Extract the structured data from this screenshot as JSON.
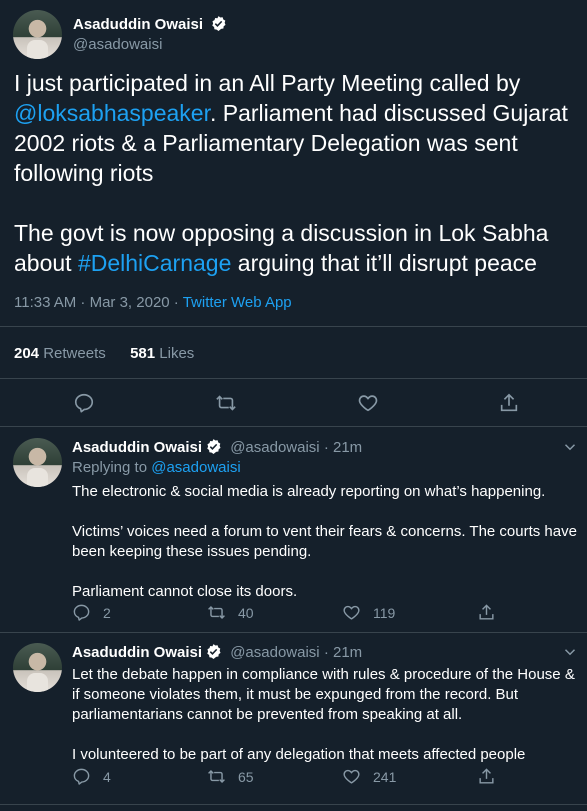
{
  "main_tweet": {
    "author_name": "Asaduddin Owaisi",
    "author_handle": "@asadowaisi",
    "text_part1": "I just participated in an All Party Meeting called by ",
    "mention": "@loksabhaspeaker",
    "text_part2": ". Parliament had discussed Gujarat 2002 riots & a Parliamentary Delegation was sent following riots\n\nThe govt is now opposing a discussion in Lok Sabha about ",
    "hashtag": "#DelhiCarnage",
    "text_part3": " arguing that it’ll disrupt peace",
    "timestamp": "11:33 AM · Mar 3, 2020 · ",
    "source": "Twitter Web App",
    "retweets_count": "204",
    "retweets_label": "Retweets",
    "likes_count": "581",
    "likes_label": "Likes",
    "icons": [
      "reply-icon",
      "retweet-icon",
      "like-icon",
      "share-icon"
    ]
  },
  "replies": [
    {
      "author_name": "Asaduddin Owaisi",
      "author_handle": "@asadowaisi",
      "time": "· 21m",
      "replying_prefix": "Replying to ",
      "replying_handle": "@asadowaisi",
      "text": "The electronic & social media is already reporting on what’s happening.\n\nVictims’ voices need a forum to vent their fears & concerns. The courts have been keeping these issues pending.\n\nParliament cannot close its doors.",
      "reply_count": "2",
      "retweet_count": "40",
      "like_count": "119"
    },
    {
      "author_name": "Asaduddin Owaisi",
      "author_handle": "@asadowaisi",
      "time": "· 21m",
      "text": "Let the debate happen in compliance with rules & procedure of the House & if someone violates them, it must be expunged from the record. But parliamentarians cannot be prevented from speaking at all.\n\nI volunteered to be part of any delegation that meets affected people",
      "reply_count": "4",
      "retweet_count": "65",
      "like_count": "241"
    }
  ],
  "colors": {
    "background": "#15202b",
    "link": "#1da1f2",
    "muted": "#8899a6",
    "divider": "#38444d"
  }
}
